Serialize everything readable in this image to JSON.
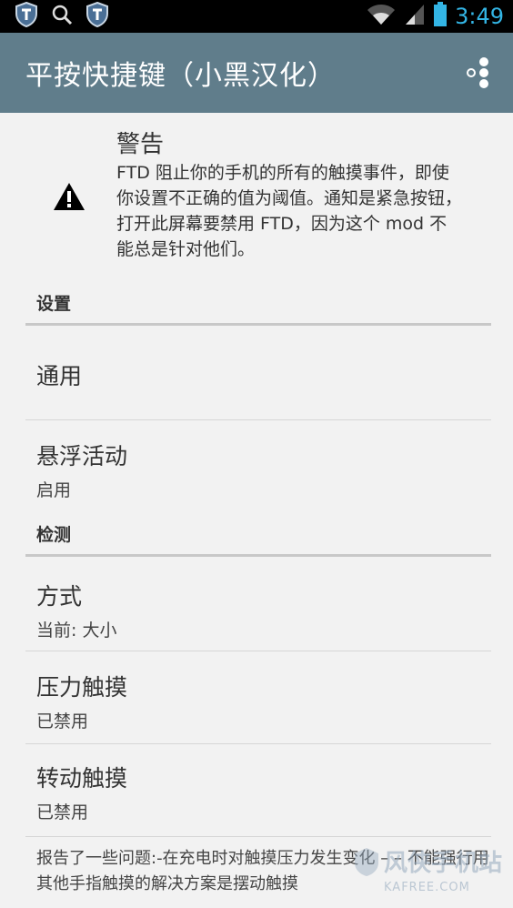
{
  "status_bar": {
    "time": "3:49"
  },
  "app_bar": {
    "title": "平按快捷键（小黑汉化）"
  },
  "warning": {
    "title": "警告",
    "text": "FTD 阻止你的手机的所有的触摸事件，即使你设置不正确的值为阈值。通知是紧急按钮，打开此屏幕要禁用 FTD，因为这个 mod 不能总是针对他们。"
  },
  "sections": {
    "settings_header": "设置",
    "general_title": "通用",
    "floating_title": "悬浮活动",
    "floating_summary": "启用",
    "detection_header": "检测",
    "method_title": "方式",
    "method_summary": "当前: 大小",
    "pressure_title": "压力触摸",
    "pressure_summary": "已禁用",
    "rotation_title": "转动触摸",
    "rotation_summary": "已禁用"
  },
  "footnote": "报告了一些问题:-在充电时对触摸压力发生变化 – – 不能强行用其他手指触摸的解决方案是摆动触摸",
  "watermark": {
    "text": "风侠手机站",
    "sub": "KAFREE.COM"
  },
  "colors": {
    "app_bar": "#607d8b",
    "status_bar": "#000000",
    "clock": "#33b5e5",
    "background": "#f2f2f2"
  },
  "icons": [
    "shield-icon",
    "search-icon",
    "shield-icon",
    "wifi-icon",
    "signal-icon",
    "battery-icon",
    "overflow-menu-icon",
    "warning-icon"
  ]
}
